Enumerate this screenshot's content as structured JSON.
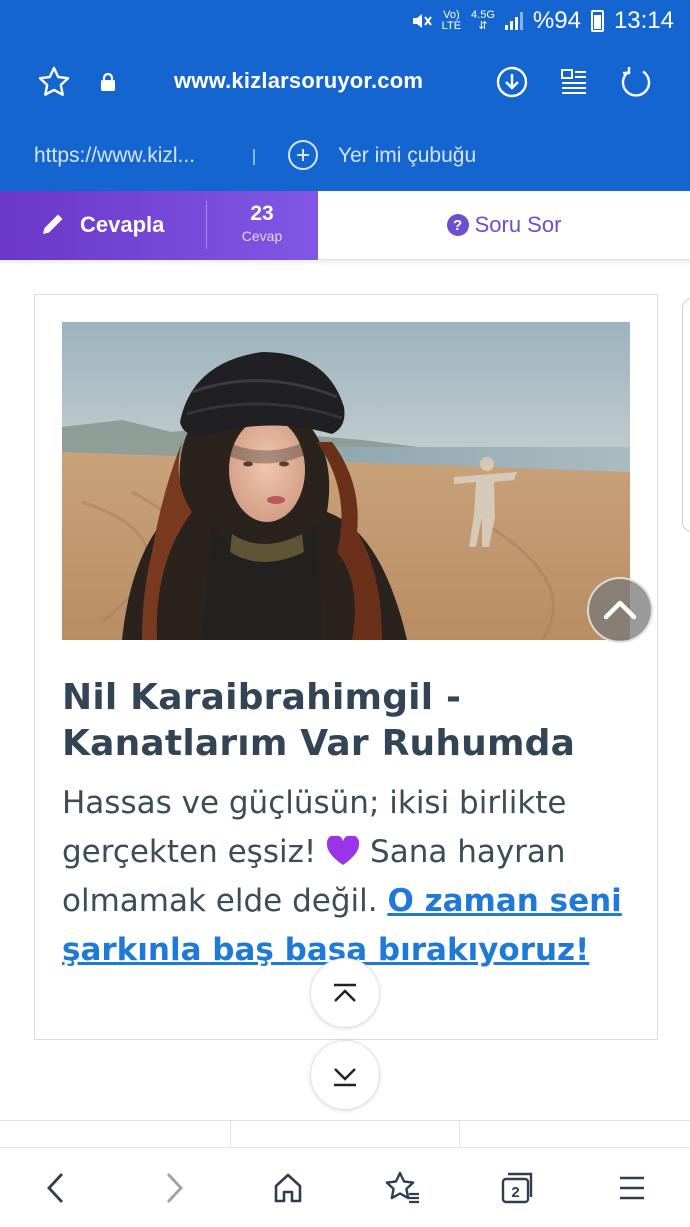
{
  "status_bar": {
    "volte": "Vo)",
    "lte": "LTE",
    "net": "4.5G",
    "battery": "%94",
    "time": "13:14"
  },
  "browser": {
    "url": "www.kizlarsoruyor.com",
    "bookmark_url": "https://www.kizl...",
    "bookmark_bar_label": "Yer imi çubuğu",
    "tab_count": "2"
  },
  "action_bar": {
    "answer_label": "Cevapla",
    "answer_count": "23",
    "answer_count_label": "Cevap",
    "ask_label": "Soru Sor"
  },
  "card": {
    "title": "Nil Karaibrahimgil - Kanatlarım Var Ruhumda",
    "text": "Hassas ve güçlüsün; ikisi birlikte gerçekten eşsiz!",
    "text_after": " Sana hayran olmamak elde değil. ",
    "link": "O zaman seni şarkınla baş başa bırakıyoruz!"
  },
  "colors": {
    "chrome": "#1565d0",
    "accent": "#6b4fd0",
    "link": "#1e7ad6",
    "title": "#334554"
  }
}
